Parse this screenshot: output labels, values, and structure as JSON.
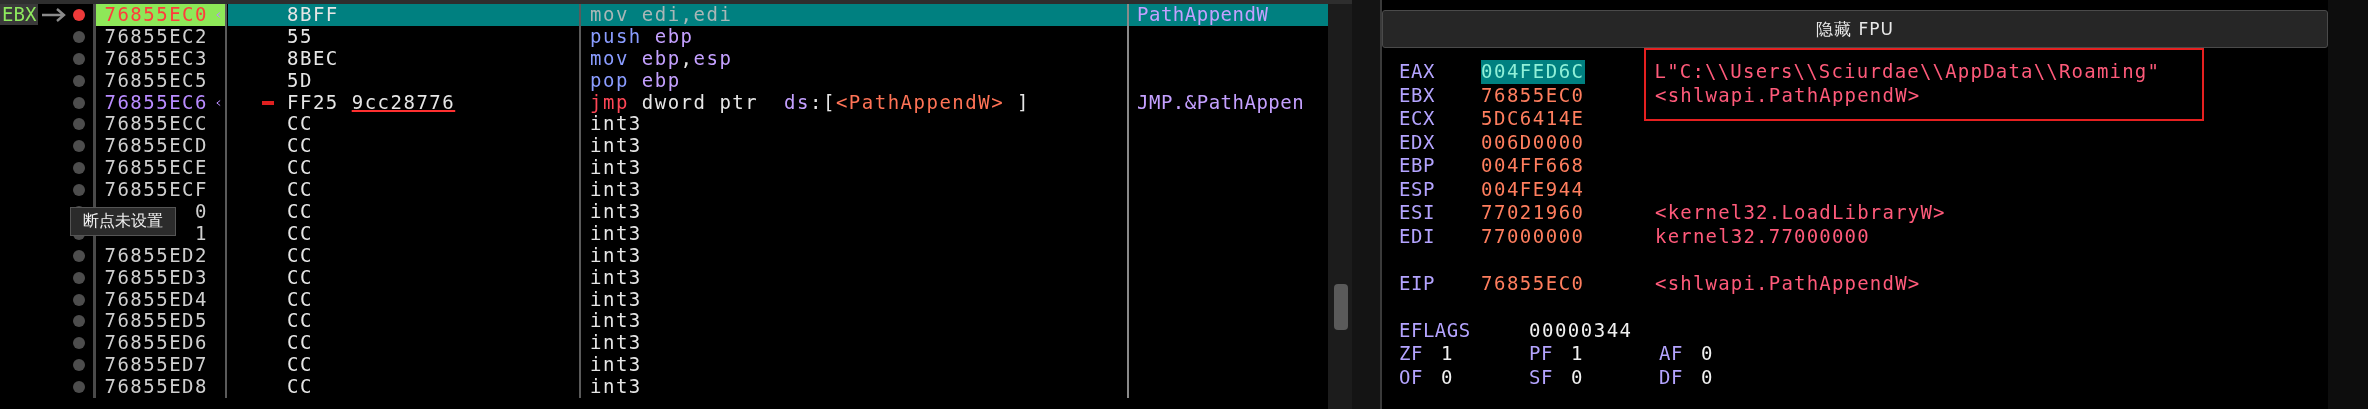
{
  "disassembly": {
    "rows": [
      {
        "register_label": "EBX",
        "address": "76855EC0",
        "selected": true,
        "breakpoint": true,
        "jump_target": true,
        "jump_source": false,
        "bytes": [
          {
            "t": "8BFF",
            "kind": "plain"
          }
        ],
        "instruction": [
          {
            "t": "mov ",
            "kind": "mnemonic"
          },
          {
            "t": "edi",
            "kind": "register"
          },
          {
            "t": ",",
            "kind": "plain"
          },
          {
            "t": "edi",
            "kind": "register"
          }
        ],
        "comment": "PathAppendW"
      },
      {
        "address": "76855EC2",
        "selected": false,
        "breakpoint": false,
        "jump_target": false,
        "jump_source": false,
        "bytes": [
          {
            "t": "55",
            "kind": "plain"
          }
        ],
        "instruction": [
          {
            "t": "push ",
            "kind": "mnemonic"
          },
          {
            "t": "ebp",
            "kind": "register"
          }
        ]
      },
      {
        "address": "76855EC3",
        "selected": false,
        "breakpoint": false,
        "jump_target": false,
        "jump_source": false,
        "bytes": [
          {
            "t": "8BEC",
            "kind": "plain"
          }
        ],
        "instruction": [
          {
            "t": "mov ",
            "kind": "mnemonic"
          },
          {
            "t": "ebp",
            "kind": "register"
          },
          {
            "t": ",",
            "kind": "plain"
          },
          {
            "t": "esp",
            "kind": "register"
          }
        ]
      },
      {
        "address": "76855EC5",
        "selected": false,
        "breakpoint": false,
        "jump_target": false,
        "jump_source": false,
        "bytes": [
          {
            "t": "5D",
            "kind": "plain"
          }
        ],
        "instruction": [
          {
            "t": "pop ",
            "kind": "mnemonic"
          },
          {
            "t": "ebp",
            "kind": "register"
          }
        ]
      },
      {
        "address": "76855EC6",
        "selected": false,
        "breakpoint": false,
        "jump_target": true,
        "jump_source": true,
        "bytes": [
          {
            "t": "FF25 ",
            "kind": "plain"
          },
          {
            "t": "9cc28776",
            "kind": "reloc"
          }
        ],
        "instruction": [
          {
            "t": "jmp ",
            "kind": "jump"
          },
          {
            "t": "dword ptr  ",
            "kind": "plain"
          },
          {
            "t": "ds",
            "kind": "register"
          },
          {
            "t": ":[",
            "kind": "plain"
          },
          {
            "t": "<PathAppendW>",
            "kind": "symbol"
          },
          {
            "t": " ]",
            "kind": "plain"
          }
        ],
        "comment": "JMP.&PathAppen"
      },
      {
        "address": "76855ECC",
        "selected": false,
        "breakpoint": false,
        "jump_target": false,
        "jump_source": false,
        "bytes": [
          {
            "t": "CC",
            "kind": "plain"
          }
        ],
        "instruction": [
          {
            "t": "int3",
            "kind": "plain"
          }
        ]
      },
      {
        "address": "76855ECD",
        "selected": false,
        "breakpoint": false,
        "jump_target": false,
        "jump_source": false,
        "bytes": [
          {
            "t": "CC",
            "kind": "plain"
          }
        ],
        "instruction": [
          {
            "t": "int3",
            "kind": "plain"
          }
        ]
      },
      {
        "address": "76855ECE",
        "selected": false,
        "breakpoint": false,
        "jump_target": false,
        "jump_source": false,
        "bytes": [
          {
            "t": "CC",
            "kind": "plain"
          }
        ],
        "instruction": [
          {
            "t": "int3",
            "kind": "plain"
          }
        ]
      },
      {
        "address": "76855ECF",
        "selected": false,
        "breakpoint": false,
        "jump_target": false,
        "jump_source": false,
        "bytes": [
          {
            "t": "CC",
            "kind": "plain"
          }
        ],
        "instruction": [
          {
            "t": "int3",
            "kind": "plain"
          }
        ]
      },
      {
        "address": "0",
        "selected": false,
        "breakpoint": false,
        "jump_target": false,
        "jump_source": false,
        "bytes": [
          {
            "t": "CC",
            "kind": "plain"
          }
        ],
        "instruction": [
          {
            "t": "int3",
            "kind": "plain"
          }
        ]
      },
      {
        "address": "1",
        "selected": false,
        "breakpoint": false,
        "jump_target": false,
        "jump_source": false,
        "bytes": [
          {
            "t": "CC",
            "kind": "plain"
          }
        ],
        "instruction": [
          {
            "t": "int3",
            "kind": "plain"
          }
        ]
      },
      {
        "address": "76855ED2",
        "selected": false,
        "breakpoint": false,
        "jump_target": false,
        "jump_source": false,
        "bytes": [
          {
            "t": "CC",
            "kind": "plain"
          }
        ],
        "instruction": [
          {
            "t": "int3",
            "kind": "plain"
          }
        ]
      },
      {
        "address": "76855ED3",
        "selected": false,
        "breakpoint": false,
        "jump_target": false,
        "jump_source": false,
        "bytes": [
          {
            "t": "CC",
            "kind": "plain"
          }
        ],
        "instruction": [
          {
            "t": "int3",
            "kind": "plain"
          }
        ]
      },
      {
        "address": "76855ED4",
        "selected": false,
        "breakpoint": false,
        "jump_target": false,
        "jump_source": false,
        "bytes": [
          {
            "t": "CC",
            "kind": "plain"
          }
        ],
        "instruction": [
          {
            "t": "int3",
            "kind": "plain"
          }
        ]
      },
      {
        "address": "76855ED5",
        "selected": false,
        "breakpoint": false,
        "jump_target": false,
        "jump_source": false,
        "bytes": [
          {
            "t": "CC",
            "kind": "plain"
          }
        ],
        "instruction": [
          {
            "t": "int3",
            "kind": "plain"
          }
        ]
      },
      {
        "address": "76855ED6",
        "selected": false,
        "breakpoint": false,
        "jump_target": false,
        "jump_source": false,
        "bytes": [
          {
            "t": "CC",
            "kind": "plain"
          }
        ],
        "instruction": [
          {
            "t": "int3",
            "kind": "plain"
          }
        ]
      },
      {
        "address": "76855ED7",
        "selected": false,
        "breakpoint": false,
        "jump_target": false,
        "jump_source": false,
        "bytes": [
          {
            "t": "CC",
            "kind": "plain"
          }
        ],
        "instruction": [
          {
            "t": "int3",
            "kind": "plain"
          }
        ]
      },
      {
        "address": "76855ED8",
        "selected": false,
        "breakpoint": false,
        "jump_target": false,
        "jump_source": false,
        "bytes": [
          {
            "t": "CC",
            "kind": "plain"
          }
        ],
        "instruction": [
          {
            "t": "int3",
            "kind": "plain"
          }
        ]
      }
    ],
    "tooltip": "断点未设置"
  },
  "registers": {
    "header_button": "隐藏 FPU",
    "general": [
      {
        "name": "EAX",
        "value": "004FED6C",
        "selected": true,
        "boxed": true,
        "comment": "L\"C:\\\\Users\\\\Sciurdae\\\\AppData\\\\Roaming\""
      },
      {
        "name": "EBX",
        "value": "76855EC0",
        "selected": false,
        "boxed": true,
        "comment": "<shlwapi.PathAppendW>"
      },
      {
        "name": "ECX",
        "value": "5DC6414E",
        "selected": false,
        "boxed": false
      },
      {
        "name": "EDX",
        "value": "006D0000",
        "selected": false,
        "boxed": false
      },
      {
        "name": "EBP",
        "value": "004FF668",
        "selected": false,
        "boxed": false
      },
      {
        "name": "ESP",
        "value": "004FE944",
        "selected": false,
        "boxed": false
      },
      {
        "name": "ESI",
        "value": "77021960",
        "selected": false,
        "boxed": false,
        "comment": "<kernel32.LoadLibraryW>"
      },
      {
        "name": "EDI",
        "value": "77000000",
        "selected": false,
        "boxed": false,
        "comment": "kernel32.77000000"
      }
    ],
    "instruction_pointer": {
      "name": "EIP",
      "value": "76855EC0",
      "comment": "<shlwapi.PathAppendW>"
    },
    "eflags": {
      "name": "EFLAGS",
      "value": "00000344"
    },
    "flags": [
      [
        {
          "name": "ZF",
          "value": "1"
        },
        {
          "name": "PF",
          "value": "1"
        },
        {
          "name": "AF",
          "value": "0"
        }
      ],
      [
        {
          "name": "OF",
          "value": "0"
        },
        {
          "name": "SF",
          "value": "0"
        },
        {
          "name": "DF",
          "value": "0"
        }
      ]
    ]
  }
}
